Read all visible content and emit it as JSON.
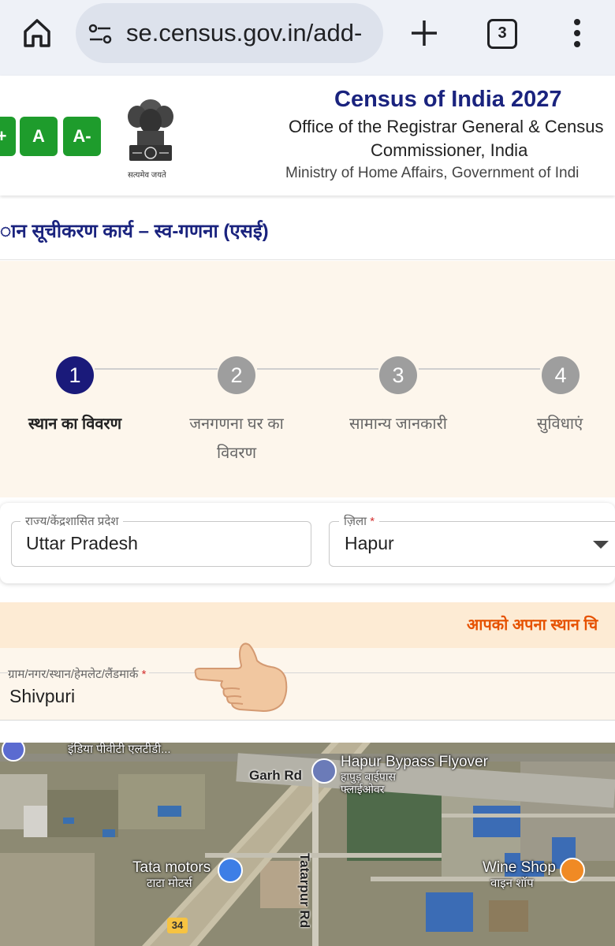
{
  "browser": {
    "url": "se.census.gov.in/add-",
    "tab_count": "3",
    "icons": [
      "home-icon",
      "site-settings-icon",
      "plus-icon",
      "tabs-icon",
      "more-vert-icon"
    ]
  },
  "header": {
    "font_controls": [
      "+",
      "A",
      "A-"
    ],
    "title": "Census of India 2027",
    "subtitle_line1": "Office of the Registrar General & Census",
    "subtitle_line2": "Commissioner, India",
    "ministry": "Ministry of Home Affairs, Government of Indi",
    "emblem_motto": "सत्यमेव जयते"
  },
  "page": {
    "title": "ान सूचीकरण कार्य – स्व-गणना (एसई)"
  },
  "stepper": {
    "active_color": "#1a1a7a",
    "inactive_color": "#9e9e9e",
    "steps": [
      {
        "number": "1",
        "label_line1": "स्थान का विवरण",
        "label_line2": ""
      },
      {
        "number": "2",
        "label_line1": "जनगणना घर का",
        "label_line2": "विवरण"
      },
      {
        "number": "3",
        "label_line1": "सामान्य जानकारी",
        "label_line2": ""
      },
      {
        "number": "4",
        "label_line1": "सुविधाएं",
        "label_line2": ""
      }
    ]
  },
  "form": {
    "state_label": "राज्य/केंद्रशासित प्रदेश",
    "state_value": "Uttar Pradesh",
    "district_label": "ज़िला",
    "district_required": "*",
    "district_value": "Hapur"
  },
  "notice": {
    "text": "आपको अपना स्थान चि",
    "color": "#e65100"
  },
  "location": {
    "label": "ग्राम/नगर/स्थान/हेमलेट/लैंडमार्क",
    "required": "*",
    "value": "Shivpuri"
  },
  "map": {
    "labels": {
      "top_poi": "इंडिया पीवीटी एलटीडी...",
      "garh_rd": "Garh Rd",
      "flyover_en": "Hapur Bypass Flyover",
      "flyover_hi1": "हापुड़ बाईपास",
      "flyover_hi2": "फ्लाईओवर",
      "tatarpur": "Tatarpur Rd",
      "tata_en": "Tata motors",
      "tata_hi": "टाटा मोटर्स",
      "wine_en": "Wine Shop",
      "wine_hi": "वाइन शॉप",
      "route": "34"
    }
  }
}
